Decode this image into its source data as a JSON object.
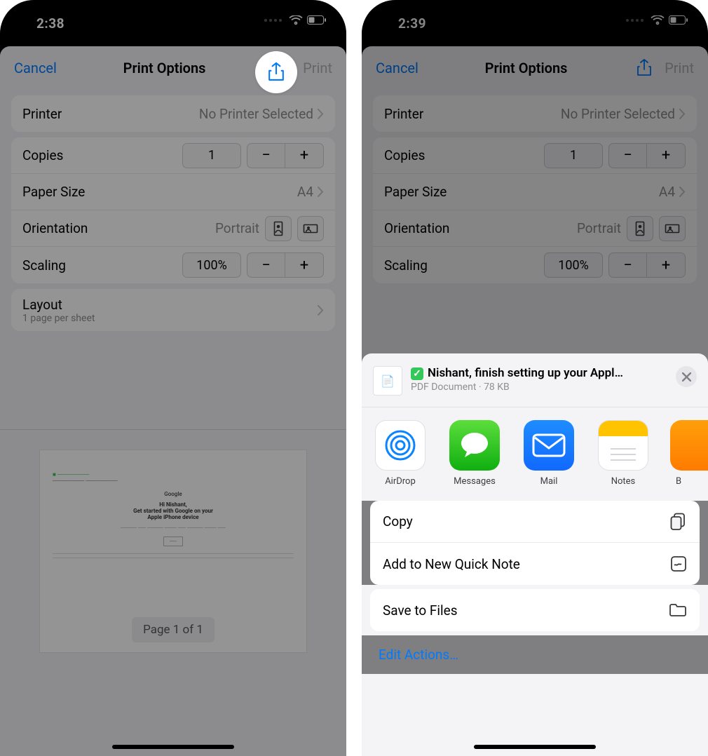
{
  "left": {
    "time": "2:38",
    "header": {
      "cancel": "Cancel",
      "title": "Print Options",
      "print": "Print"
    },
    "printer": {
      "label": "Printer",
      "value": "No Printer Selected"
    },
    "copies": {
      "label": "Copies",
      "value": "1"
    },
    "paper_size": {
      "label": "Paper Size",
      "value": "A4"
    },
    "orientation": {
      "label": "Orientation",
      "value": "Portrait"
    },
    "scaling": {
      "label": "Scaling",
      "value": "100%"
    },
    "layout": {
      "label": "Layout",
      "sub": "1 page per sheet"
    },
    "preview": {
      "badge": "Page 1 of 1",
      "head": "Google",
      "line1": "Hi Nishant,",
      "line2": "Get started with Google on your",
      "line3": "Apple iPhone device"
    }
  },
  "right": {
    "time": "2:39",
    "header": {
      "cancel": "Cancel",
      "title": "Print Options",
      "print": "Print"
    },
    "printer": {
      "label": "Printer",
      "value": "No Printer Selected"
    },
    "copies": {
      "label": "Copies",
      "value": "1"
    },
    "paper_size": {
      "label": "Paper Size",
      "value": "A4"
    },
    "orientation": {
      "label": "Orientation",
      "value": "Portrait"
    },
    "scaling": {
      "label": "Scaling",
      "value": "100%"
    },
    "share": {
      "doc_title": "Nishant, finish setting up your Appl…",
      "doc_sub": "PDF Document · 78 KB",
      "apps": {
        "airdrop": "AirDrop",
        "messages": "Messages",
        "mail": "Mail",
        "notes": "Notes",
        "books": "B"
      },
      "actions": {
        "copy": "Copy",
        "quicknote": "Add to New Quick Note",
        "save_files": "Save to Files",
        "edit": "Edit Actions…"
      }
    }
  }
}
